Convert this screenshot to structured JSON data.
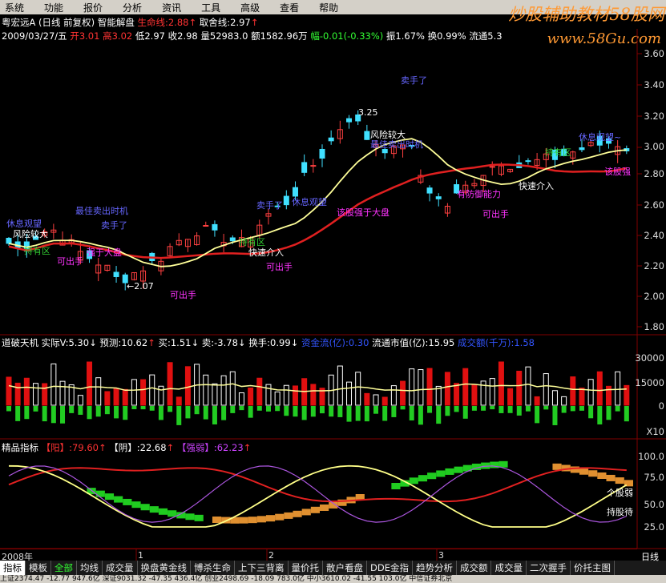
{
  "menu": [
    "系统",
    "功能",
    "报价",
    "分析",
    "资讯",
    "工具",
    "高级",
    "查看",
    "帮助"
  ],
  "watermark": "炒股辅助教材58股网",
  "watermark_url": "www.58Gu.com",
  "header": {
    "line1_stock": "粤宏远A",
    "line1_period": "(日线 前复权)",
    "line1_formula": "智能解盘",
    "line1_shengming": "生命线:2.88",
    "line1_quhan": "取舍线:2.97",
    "line2": "2009/03/27/五",
    "open": "开3.01",
    "high": "高3.02",
    "low": "低2.97",
    "close": "收2.98",
    "vol": "量52983.0",
    "amt": "额1582.96万",
    "chg": "幅-0.01(-0.33%)",
    "amp": "振1.67%",
    "turn": "换0.99%",
    "flow": "流通5.3"
  },
  "price_axis": [
    "3.60",
    "3.40",
    "3.20",
    "3.00",
    "2.80",
    "2.60",
    "2.40",
    "2.20",
    "2.00",
    "1.80"
  ],
  "annotations": [
    {
      "text": "卖手了",
      "color": "#6666ff"
    },
    {
      "text": "3.25",
      "color": "#ffffff"
    },
    {
      "text": "风险较大",
      "color": "#ffffff"
    },
    {
      "text": "最佳卖出时机",
      "color": "#6666ff"
    },
    {
      "text": "休息观望~",
      "color": "#6666ff"
    },
    {
      "text": "持有区",
      "color": "#33cc33"
    },
    {
      "text": "该股强",
      "color": "#ff33ff"
    },
    {
      "text": "快速介入",
      "color": "#ffffff"
    },
    {
      "text": "可出手",
      "color": "#ff33ff"
    },
    {
      "text": "有防御能力",
      "color": "#ff33ff"
    },
    {
      "text": "休息观望",
      "color": "#6666ff"
    },
    {
      "text": "该股强于大盘",
      "color": "#ff33ff"
    },
    {
      "text": "卖手了",
      "color": "#6666ff"
    },
    {
      "text": "持有区",
      "color": "#33cc33"
    },
    {
      "text": "快速介入",
      "color": "#ffffff"
    },
    {
      "text": "可出手",
      "color": "#ff33ff"
    },
    {
      "text": "休息观望",
      "color": "#6666ff"
    },
    {
      "text": "最佳卖出时机",
      "color": "#6666ff"
    },
    {
      "text": "风险较大",
      "color": "#ffffff"
    },
    {
      "text": "卖手了",
      "color": "#6666ff"
    },
    {
      "text": "持有区",
      "color": "#33cc33"
    },
    {
      "text": "可出手",
      "color": "#ff33ff"
    },
    {
      "text": "强于大盘",
      "color": "#ff33ff"
    },
    {
      "text": "←2.07",
      "color": "#ffffff"
    },
    {
      "text": "可出手",
      "color": "#ff33ff"
    }
  ],
  "vol_header": {
    "name": "道破天机",
    "actual": "实际V:5.30",
    "forecast": "预测:10.62",
    "buy": "买:1.51",
    "sell": "卖:-3.78",
    "turn": "换手:0.99",
    "fund": "资金流(亿):0.30",
    "mktcap": "流通市值(亿):15.95",
    "amt": "成交额(千万):1.58"
  },
  "vol_axis": [
    "30000",
    "15000",
    "0"
  ],
  "vol_unit": "X10",
  "ind_header": {
    "name": "精品指标",
    "yang": "【阳】:79.60",
    "yin": "【阴】:22.68",
    "strong": "【强弱】:62.23"
  },
  "ind_axis": [
    "100.0",
    "75.0",
    "50.0",
    "25.0"
  ],
  "ind_labels": [
    "个股弱",
    "持股待"
  ],
  "period_axis": {
    "year": "2008年",
    "marks": [
      "1",
      "2",
      "3"
    ]
  },
  "tabs": [
    "指标",
    "模板",
    "全部",
    "均线",
    "成交量",
    "换盘黄金线",
    "博杀生命",
    "上下三背离",
    "量价托",
    "散户看盘",
    "DDE金指",
    "趋势分析",
    "成交额",
    "成交量",
    "二次握手",
    "价托主图"
  ],
  "right_tab": "日线",
  "status": "上证2374.47 -12.77 947.6亿  深证9031.32 -47.35 436.4亿  创业2498.69 -18.09 783.0亿  中小3610.02 -41.55 103.0亿  中信证券北京"
}
